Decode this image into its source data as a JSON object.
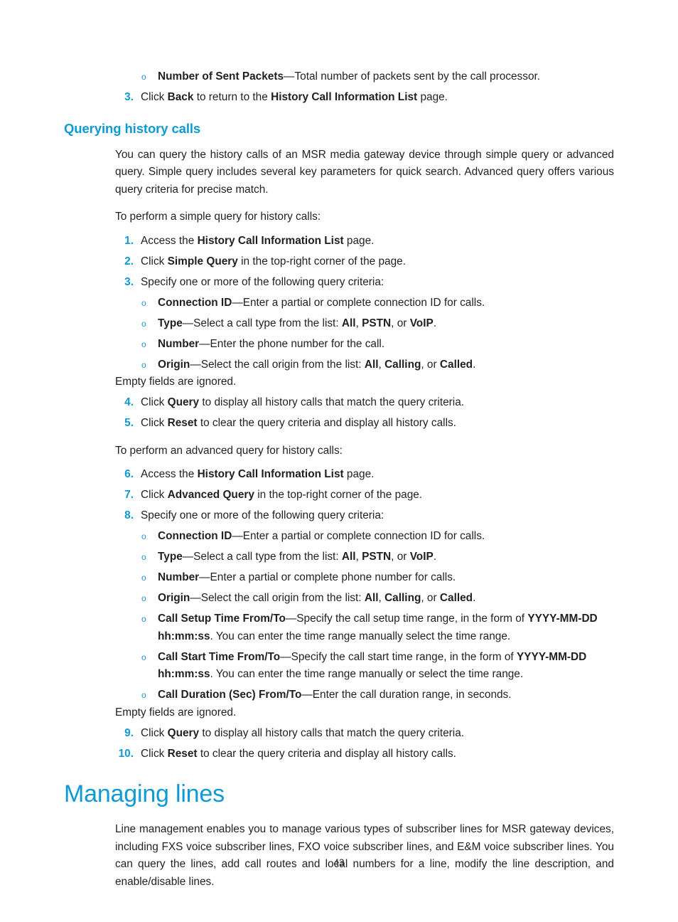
{
  "page": {
    "number": "43",
    "accent_color": "#0d9ad5",
    "text_color": "#231f20",
    "background": "#ffffff"
  },
  "top_bullet": {
    "marker": "o",
    "term": "Number of Sent Packets",
    "dash": "—",
    "text": "Total number of packets sent by the call processor."
  },
  "step3_top": {
    "num": "3.",
    "p1": "Click ",
    "b1": "Back",
    "p2": " to return to the ",
    "b2": "History Call Information List",
    "p3": " page."
  },
  "section_querying": {
    "heading": "Querying history calls",
    "intro": "You can query the history calls of an MSR media gateway device through simple query or advanced query. Simple query includes several key parameters for quick search. Advanced query offers various query criteria for precise match.",
    "simple_lead": "To perform a simple query for history calls:",
    "simple_steps": [
      {
        "num": "1.",
        "p1": "Access the ",
        "b1": "History Call Information List",
        "p2": " page."
      },
      {
        "num": "2.",
        "p1": "Click ",
        "b1": "Simple Query",
        "p2": " in the top-right corner of the page."
      },
      {
        "num": "3.",
        "p1": "Specify one or more of the following query criteria:",
        "b1": "",
        "p2": ""
      }
    ],
    "simple_criteria": [
      {
        "marker": "o",
        "term": "Connection ID",
        "dash": "—",
        "text": "Enter a partial or complete connection ID for calls."
      },
      {
        "marker": "o",
        "term": "Type",
        "dash": "—",
        "text": "Select a call type from the list: ",
        "opts": [
          "All",
          "PSTN",
          "VoIP"
        ],
        "sep1": ", ",
        "sep2": ", or ",
        "end": "."
      },
      {
        "marker": "o",
        "term": "Number",
        "dash": "—",
        "text": "Enter the phone number for the call."
      },
      {
        "marker": "o",
        "term": "Origin",
        "dash": "—",
        "text": "Select the call origin from the list: ",
        "opts": [
          "All",
          "Calling",
          "Called"
        ],
        "sep1": ", ",
        "sep2": ", or ",
        "end": "."
      }
    ],
    "empty_note": "Empty fields are ignored.",
    "simple_steps_tail": [
      {
        "num": "4.",
        "p1": "Click ",
        "b1": "Query",
        "p2": " to display all history calls that match the query criteria."
      },
      {
        "num": "5.",
        "p1": "Click ",
        "b1": "Reset",
        "p2": " to clear the query criteria and display all history calls."
      }
    ],
    "advanced_lead": "To perform an advanced query for history calls:",
    "advanced_steps": [
      {
        "num": "6.",
        "p1": "Access the ",
        "b1": "History Call Information List",
        "p2": " page."
      },
      {
        "num": "7.",
        "p1": "Click ",
        "b1": "Advanced Query",
        "p2": " in the top-right corner of the page."
      },
      {
        "num": "8.",
        "p1": "Specify one or more of the following query criteria:",
        "b1": "",
        "p2": ""
      }
    ],
    "advanced_criteria": [
      {
        "marker": "o",
        "term": "Connection ID",
        "dash": "—",
        "text": "Enter a partial or complete connection ID for calls."
      },
      {
        "marker": "o",
        "term": "Type",
        "dash": "—",
        "text": "Select a call type from the list: ",
        "opts": [
          "All",
          "PSTN",
          "VoIP"
        ],
        "sep1": ", ",
        "sep2": ", or ",
        "end": "."
      },
      {
        "marker": "o",
        "term": "Number",
        "dash": "—",
        "text": "Enter a partial or complete phone number for calls."
      },
      {
        "marker": "o",
        "term": "Origin",
        "dash": "—",
        "text": "Select the call origin from the list: ",
        "opts": [
          "All",
          "Calling",
          "Called"
        ],
        "sep1": ", ",
        "sep2": ", or ",
        "end": "."
      }
    ],
    "time_criteria": [
      {
        "marker": "o",
        "term": "Call Setup Time From/To",
        "dash": "—",
        "t1": "Specify the call setup time range, in the form of ",
        "fmt1": "YYYY-MM-DD hh:mm:ss",
        "t2": ". You can enter the time range manually select the time range."
      },
      {
        "marker": "o",
        "term": "Call Start Time From/To",
        "dash": "—",
        "t1": "Specify the call start time range, in the form of ",
        "fmt1": "YYYY-MM-DD hh:mm:ss",
        "t2": ". You can enter the time range manually or select the time range."
      }
    ],
    "duration_criterion": {
      "marker": "o",
      "term": "Call Duration (Sec) From/To",
      "dash": "—",
      "text": "Enter the call duration range, in seconds."
    },
    "empty_note2": "Empty fields are ignored.",
    "advanced_steps_tail": [
      {
        "num": "9.",
        "p1": "Click ",
        "b1": "Query",
        "p2": " to display all history calls that match the query criteria."
      },
      {
        "num": "10.",
        "p1": "Click ",
        "b1": "Reset",
        "p2": " to clear the query criteria and display all history calls."
      }
    ]
  },
  "section_managing": {
    "heading": "Managing lines",
    "paragraph": "Line management enables you to manage various types of subscriber lines for MSR gateway devices, including FXS voice subscriber lines, FXO voice subscriber lines, and E&M voice subscriber lines. You can query the lines, add call routes and local numbers for a line, modify the line description, and enable/disable lines."
  }
}
